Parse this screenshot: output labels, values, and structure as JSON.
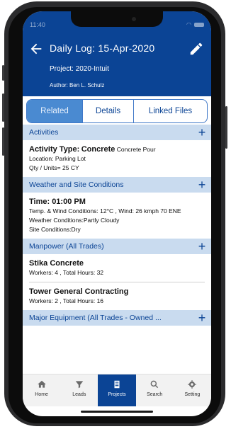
{
  "status": {
    "time": "11:40"
  },
  "header": {
    "title": "Daily Log: 15-Apr-2020",
    "project": "Project: 2020-Intuit",
    "author": "Author: Ben L. Schulz"
  },
  "tabs": [
    {
      "label": "Related",
      "active": true
    },
    {
      "label": "Details",
      "active": false
    },
    {
      "label": "Linked Files",
      "active": false
    }
  ],
  "sections": {
    "activities": {
      "title": "Activities",
      "type_label": "Activity Type:",
      "type_value": "Concrete",
      "type_detail": "Concrete Pour",
      "location": "Location:   Parking Lot",
      "qty": "Qty / Units= 25 CY"
    },
    "weather": {
      "title": "Weather and Site Conditions",
      "time": "Time: 01:00 PM",
      "temp_wind": "Temp. & Wind Conditions: 12°C , Wind: 26 kmph 70 ENE",
      "conditions": "Weather Conditions:Partly Cloudy",
      "site": "Site Conditions:Dry"
    },
    "manpower": {
      "title": "Manpower (All Trades)",
      "entries": [
        {
          "name": "Stika Concrete",
          "detail": "Workers: 4 , Total Hours: 32"
        },
        {
          "name": "Tower General Contracting",
          "detail": "Workers: 2 , Total Hours: 16"
        }
      ]
    },
    "equipment": {
      "title": "Major Equipment (All Trades - Owned ..."
    }
  },
  "tabbar": [
    {
      "label": "Home",
      "icon": "home-icon",
      "active": false
    },
    {
      "label": "Leads",
      "icon": "filter-icon",
      "active": false
    },
    {
      "label": "Projects",
      "icon": "projects-icon",
      "active": true
    },
    {
      "label": "Search",
      "icon": "search-icon",
      "active": false
    },
    {
      "label": "Setting",
      "icon": "gear-icon",
      "active": false
    }
  ],
  "colors": {
    "primary": "#0b4495",
    "section_bg": "#c9dbef",
    "tab_active": "#4a8ad1"
  }
}
